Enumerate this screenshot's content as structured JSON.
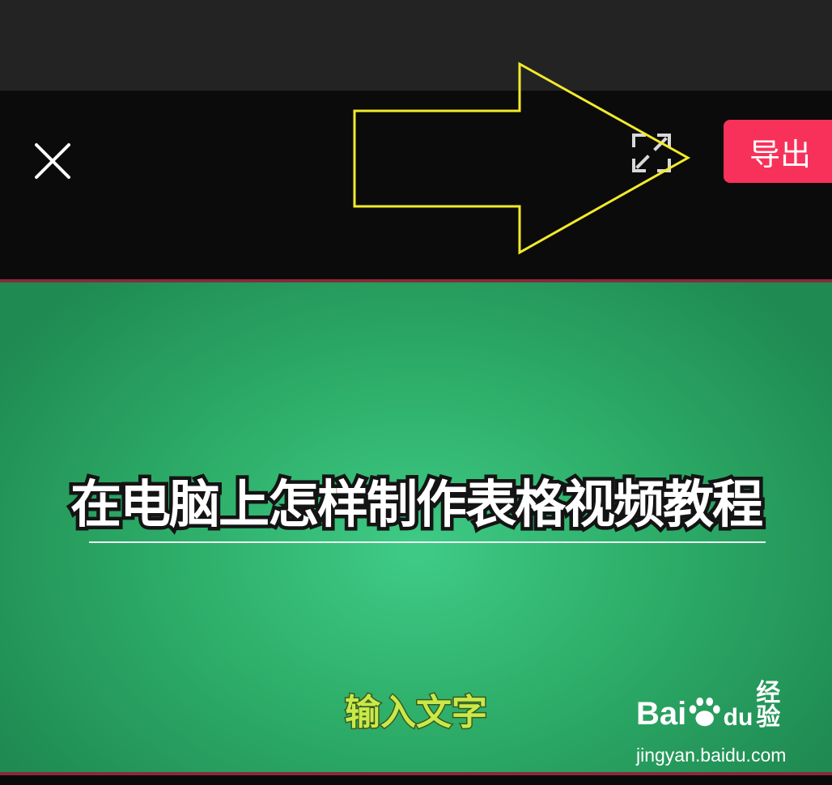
{
  "toolbar": {
    "close_icon": "close-icon",
    "fullscreen_icon": "fullscreen-icon",
    "export_label": "导出"
  },
  "preview": {
    "title": "在电脑上怎样制作表格视频教程",
    "placeholder": "输入文字"
  },
  "watermark": {
    "brand": "Bai",
    "brand_du": "du",
    "product": "经验",
    "url": "jingyan.baidu.com"
  },
  "colors": {
    "export_button": "#f8315a",
    "annotation_arrow": "#f2ea2a",
    "preview_green": "#2eaf6a",
    "placeholder_text": "#c9e94a"
  }
}
